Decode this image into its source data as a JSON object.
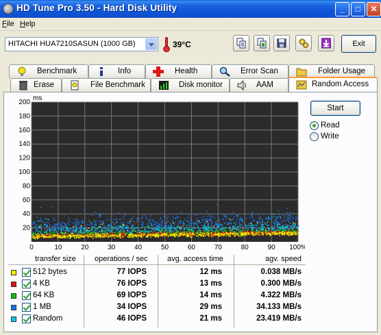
{
  "window": {
    "title": "HD Tune Pro 3.50 - Hard Disk Utility",
    "minimize_glyph": "_",
    "maximize_glyph": "□",
    "close_glyph": "✕"
  },
  "menu": [
    "File",
    "Help"
  ],
  "toolbar": {
    "drive": "HITACHI HUA7210SASUN (1000 GB)",
    "temperature": "39°C",
    "icons": [
      "copy-icon",
      "copy-all-icon",
      "save-icon",
      "options-icon",
      "download-icon"
    ],
    "exit_label": "Exit"
  },
  "tabs_row1": [
    "Benchmark",
    "Info",
    "Health",
    "Error Scan",
    "Folder Usage"
  ],
  "tabs_row2": [
    "Erase",
    "File Benchmark",
    "Disk monitor",
    "AAM",
    "Random Access"
  ],
  "active_tab": "Random Access",
  "controls": {
    "start_label": "Start",
    "read_label": "Read",
    "write_label": "Write",
    "selected_mode": "Read"
  },
  "chart_data": {
    "type": "scatter",
    "ylabel": "ms",
    "ylim": [
      0,
      200
    ],
    "y_ticks": [
      "200",
      "180",
      "160",
      "140",
      "120",
      "100",
      "80",
      "60",
      "40",
      "20"
    ],
    "xlim": [
      0,
      100
    ],
    "x_ticks": [
      "0",
      "10",
      "20",
      "30",
      "40",
      "50",
      "60",
      "70",
      "80",
      "90",
      "100%"
    ],
    "grid": true,
    "background": "#2b2b2b",
    "series": [
      {
        "color": "#f0f000",
        "values": [
          [
            0,
            8
          ],
          [
            10,
            8.5
          ],
          [
            20,
            9
          ],
          [
            30,
            9.5
          ],
          [
            40,
            10
          ],
          [
            50,
            10.5
          ],
          [
            60,
            11
          ],
          [
            70,
            11.5
          ],
          [
            80,
            12
          ],
          [
            90,
            12.5
          ],
          [
            100,
            13
          ]
        ]
      },
      {
        "color": "#e01010",
        "values": [
          [
            0,
            9
          ],
          [
            10,
            9.5
          ],
          [
            20,
            10
          ],
          [
            30,
            10.5
          ],
          [
            40,
            11
          ],
          [
            50,
            11.5
          ],
          [
            60,
            12
          ],
          [
            70,
            12.5
          ],
          [
            80,
            13
          ],
          [
            90,
            13.5
          ],
          [
            100,
            14
          ]
        ]
      },
      {
        "color": "#10c010",
        "values": [
          [
            0,
            10
          ],
          [
            10,
            10.5
          ],
          [
            20,
            11
          ],
          [
            30,
            11.5
          ],
          [
            40,
            12
          ],
          [
            50,
            12.5
          ],
          [
            60,
            13
          ],
          [
            70,
            13.5
          ],
          [
            80,
            14
          ],
          [
            90,
            14.5
          ],
          [
            100,
            15
          ]
        ]
      },
      {
        "color": "#1870e8",
        "values": [
          [
            0,
            23
          ],
          [
            10,
            23.5
          ],
          [
            20,
            24
          ],
          [
            30,
            25
          ],
          [
            40,
            26
          ],
          [
            50,
            27
          ],
          [
            60,
            28
          ],
          [
            70,
            29
          ],
          [
            80,
            30
          ],
          [
            90,
            31
          ],
          [
            100,
            32
          ]
        ]
      },
      {
        "color": "#10c8e0",
        "values": [
          [
            0,
            16
          ],
          [
            10,
            16.5
          ],
          [
            20,
            17
          ],
          [
            30,
            17.5
          ],
          [
            40,
            18
          ],
          [
            50,
            18.5
          ],
          [
            60,
            19
          ],
          [
            70,
            19.5
          ],
          [
            80,
            20
          ],
          [
            90,
            20.5
          ],
          [
            100,
            21
          ]
        ]
      }
    ]
  },
  "results": {
    "headers": [
      "transfer size",
      "operations / sec",
      "avg. access time",
      "agv. speed"
    ],
    "rows": [
      {
        "color": "#f0f000",
        "checked": true,
        "size": "512 bytes",
        "ops": "77 IOPS",
        "access": "12 ms",
        "speed": "0.038 MB/s"
      },
      {
        "color": "#e01010",
        "checked": true,
        "size": "4 KB",
        "ops": "76 IOPS",
        "access": "13 ms",
        "speed": "0.300 MB/s"
      },
      {
        "color": "#10c010",
        "checked": true,
        "size": "64 KB",
        "ops": "69 IOPS",
        "access": "14 ms",
        "speed": "4.322 MB/s"
      },
      {
        "color": "#1870e8",
        "checked": true,
        "size": "1 MB",
        "ops": "34 IOPS",
        "access": "29 ms",
        "speed": "34.133 MB/s"
      },
      {
        "color": "#10c8e0",
        "checked": true,
        "size": "Random",
        "ops": "46 IOPS",
        "access": "21 ms",
        "speed": "23.419 MB/s"
      }
    ]
  }
}
